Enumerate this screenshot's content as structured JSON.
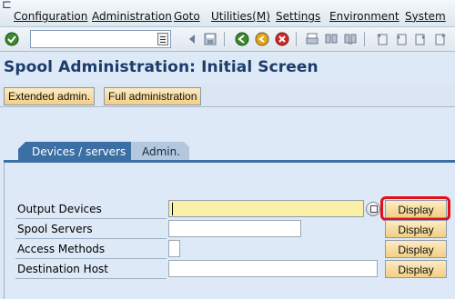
{
  "menu": {
    "items": [
      {
        "label": "Configuration"
      },
      {
        "label": "Administration"
      },
      {
        "label": "Goto"
      },
      {
        "label": "Utilities(M)"
      },
      {
        "label": "Settings"
      },
      {
        "label": "Environment"
      },
      {
        "label": "System"
      }
    ]
  },
  "toolbar": {
    "command_field_value": "",
    "icons": [
      "enter-icon",
      "command-field",
      "back-arrow-icon",
      "save-icon",
      "back-icon",
      "exit-icon",
      "cancel-icon",
      "print-icon",
      "find-icon",
      "find-next-icon",
      "first-page-icon",
      "previous-page-icon",
      "next-page-icon",
      "last-page-icon"
    ]
  },
  "page": {
    "title": "Spool Administration: Initial Screen"
  },
  "app_toolbar": {
    "extended_admin": "Extended admin.",
    "full_admin": "Full administration"
  },
  "tabs": {
    "active": "Devices / servers",
    "inactive": "Admin."
  },
  "form": {
    "rows": [
      {
        "label": "Output Devices",
        "value": "",
        "button": "Display"
      },
      {
        "label": "Spool Servers",
        "value": "",
        "button": "Display"
      },
      {
        "label": "Access Methods",
        "value": "",
        "button": "Display"
      },
      {
        "label": "Destination Host",
        "value": "",
        "button": "Display"
      }
    ]
  },
  "colors": {
    "title": "#1d3c6a",
    "tab_active": "#3c6fa4",
    "highlight": "#e3101c",
    "required_field": "#fbf0a8"
  }
}
